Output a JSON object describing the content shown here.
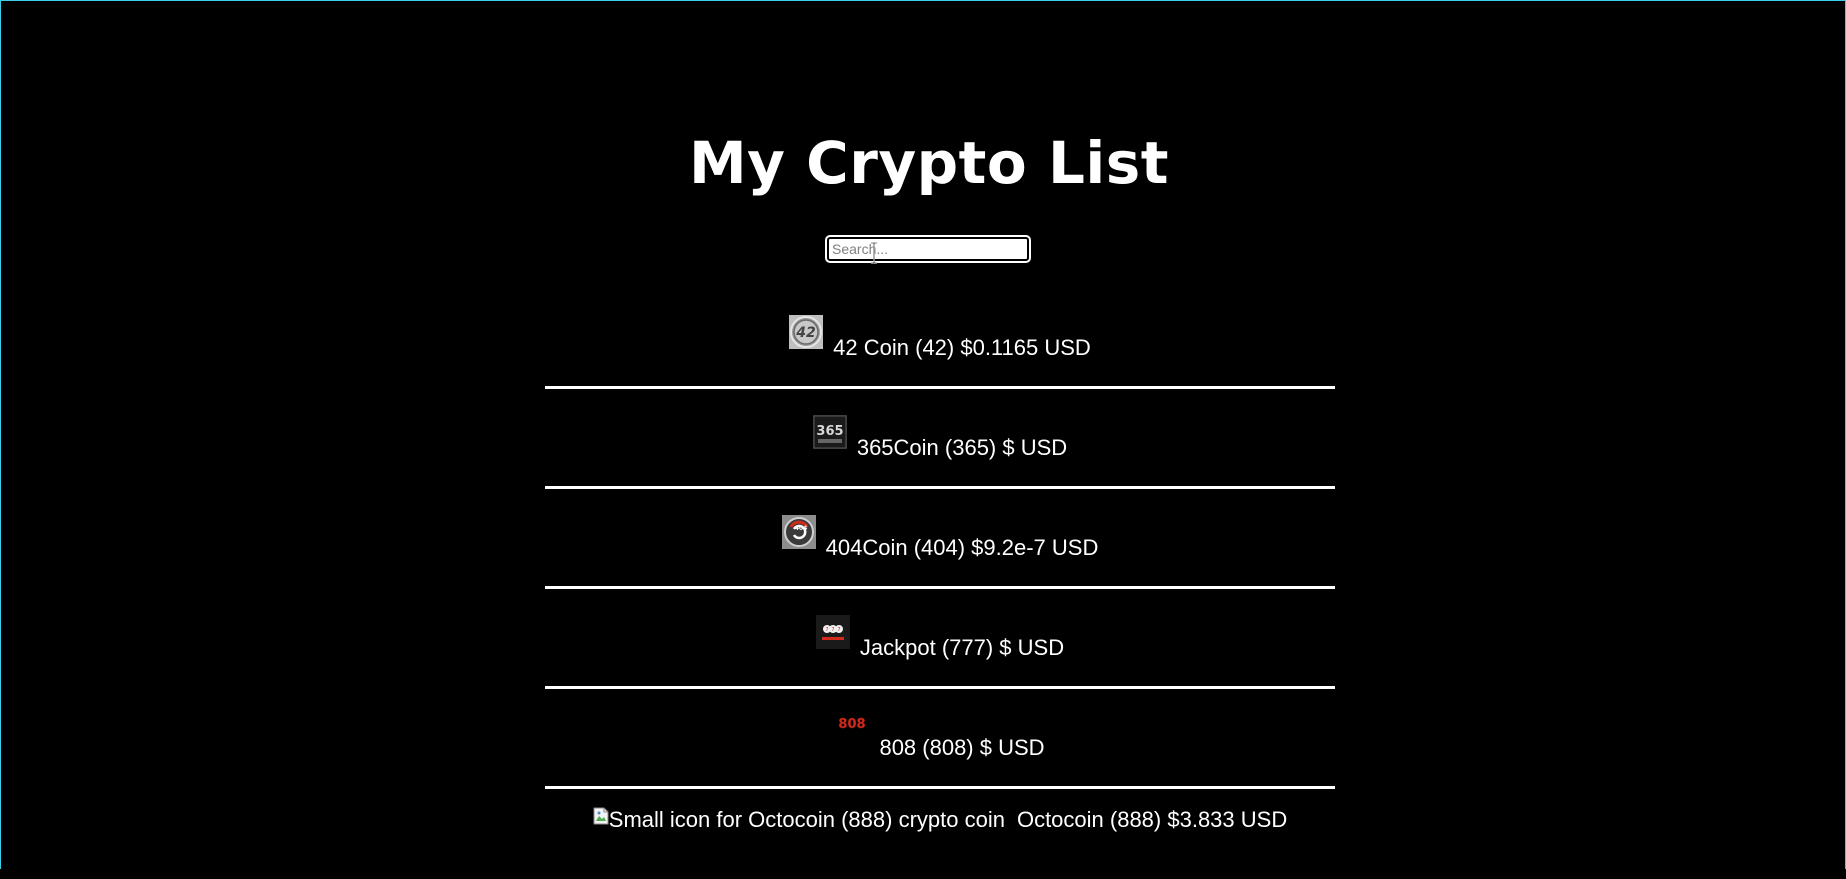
{
  "page": {
    "title": "My Crypto List"
  },
  "search": {
    "placeholder": "Search..."
  },
  "coins": [
    {
      "name": "42 Coin",
      "symbol": "42",
      "text": "42 Coin (42) $0.1165 USD",
      "icon": "42-coin-logo-icon"
    },
    {
      "name": "365Coin",
      "symbol": "365",
      "text": "365Coin (365) $ USD",
      "icon": "365coin-logo-icon"
    },
    {
      "name": "404Coin",
      "symbol": "404",
      "text": "404Coin (404) $9.2e-7 USD",
      "icon": "404coin-logo-icon"
    },
    {
      "name": "Jackpot",
      "symbol": "777",
      "text": "Jackpot (777) $ USD",
      "icon": "jackpot-logo-icon"
    },
    {
      "name": "808",
      "symbol": "808",
      "text": "808 (808) $ USD",
      "icon": "808-logo-icon"
    },
    {
      "name": "Octocoin",
      "symbol": "888",
      "text": "Octocoin (888) $3.833 USD",
      "icon_alt": "Small icon for Octocoin (888) crypto coin",
      "icon": "broken-image-icon"
    }
  ],
  "colors": {
    "background": "#000000",
    "text": "#ffffff",
    "divider": "#ffffff",
    "accent_808": "#d42a1c"
  }
}
